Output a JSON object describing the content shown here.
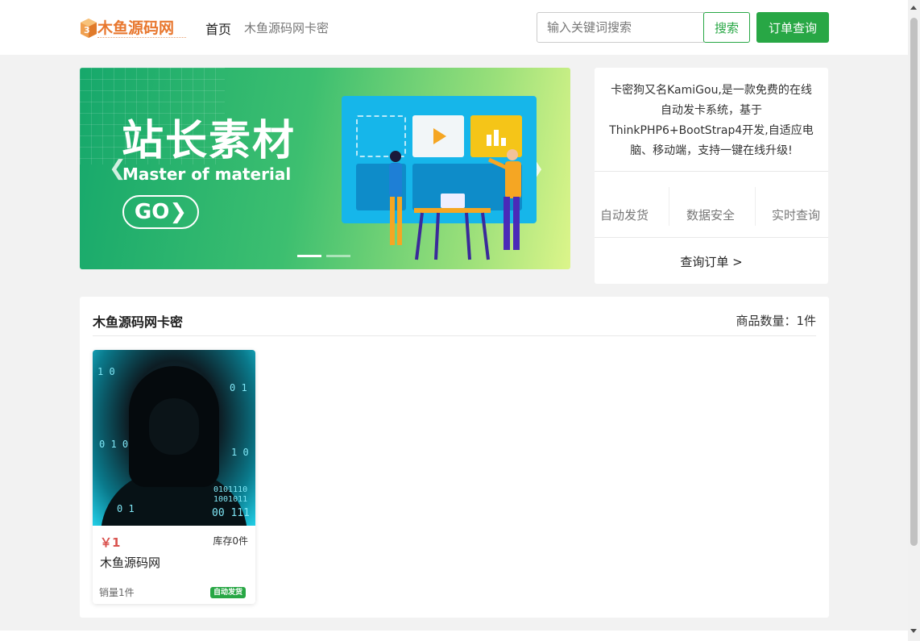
{
  "header": {
    "logo_text": "木鱼源码网",
    "nav_home": "首页",
    "nav_shop": "木鱼源码网卡密",
    "search_placeholder": "输入关键词搜索",
    "search_button": "搜索",
    "order_button": "订单查询"
  },
  "banner": {
    "title": "站长素材",
    "subtitle": "Master of material",
    "go_label": "GO❯",
    "prev_icon": "❮",
    "next_icon": "❯",
    "slide_count": 2,
    "active_slide": 0
  },
  "info_panel": {
    "description": "卡密狗又名KamiGou,是一款免费的在线自动发卡系统，基于ThinkPHP6+BootStrap4开发,自适应电脑、移动端，支持一键在线升级!",
    "features": [
      "自动发货",
      "数据安全",
      "实时查询"
    ],
    "query_link": "查询订单 >"
  },
  "products": {
    "title": "木鱼源码网卡密",
    "count_label": "商品数量：1件",
    "items": [
      {
        "price": "￥1",
        "stock": "库存0件",
        "name": "木鱼源码网",
        "sales": "销量1件",
        "badge": "自动发货"
      }
    ]
  },
  "colors": {
    "accent": "#28a745",
    "logo": "#e8772e",
    "price": "#d9534f"
  }
}
